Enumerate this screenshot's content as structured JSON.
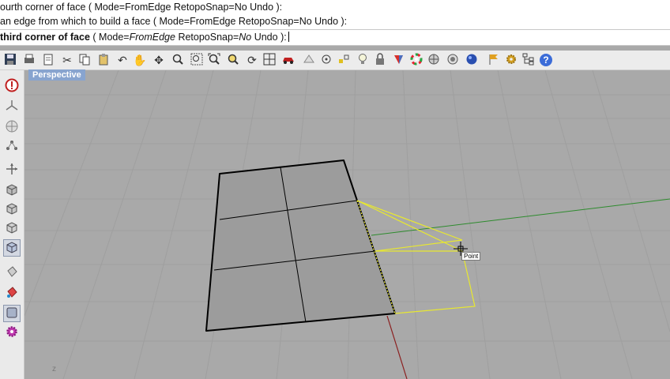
{
  "command_history": [
    "ourth corner of face ( Mode=FromEdge  RetopoSnap=No  Undo ):",
    "an edge from which to build a face ( Mode=FromEdge  RetopoSnap=No  Undo ):"
  ],
  "command_prompt": {
    "main": "third corner of face",
    "open": " ( ",
    "mode_label": "Mode=",
    "mode_value": "FromEdge",
    "snap_label": "  RetopoSnap=",
    "snap_value": "No",
    "undo": "  Undo",
    "close": " ):"
  },
  "toolbar_icons": [
    "save-icon",
    "print-icon",
    "copy-page-icon",
    "cut-icon",
    "copy-icon",
    "paste-icon",
    "undo-icon",
    "pan-hand-icon",
    "rotate-icon",
    "zoom-icon",
    "zoom-window-icon",
    "zoom-extents-icon",
    "zoom-selected-icon",
    "rotate-view-icon",
    "grid-icon",
    "car-icon",
    "properties-icon",
    "snap-icon",
    "points-icon",
    "light-bulb-icon",
    "lock-icon",
    "render-icon",
    "color-wheel-icon",
    "materials-icon",
    "environment-icon",
    "sphere-icon",
    "flag-icon",
    "gear-icon",
    "tree-icon",
    "help-icon"
  ],
  "sidebar_icons": [
    "info-icon",
    "origin-axes-icon",
    "sphere-grid-icon",
    "mesh-points-icon",
    "gumball-icon",
    "box-top-icon",
    "box-front-icon",
    "box-right-icon",
    "box-perspective-icon",
    "paint-bucket-icon",
    "material-tool-icon",
    "display-icon",
    "settings-gear-icon"
  ],
  "viewport": {
    "label": "Perspective",
    "axis_label": "z",
    "snap_tooltip": "Point"
  },
  "colors": {
    "viewport_bg": "#a9a9a9",
    "label_bg": "#88a4cf",
    "surface_fill": "#9c9c9c",
    "preview_line": "#e8e830",
    "x_axis": "#8b2020",
    "y_axis": "#2e8b2e"
  }
}
